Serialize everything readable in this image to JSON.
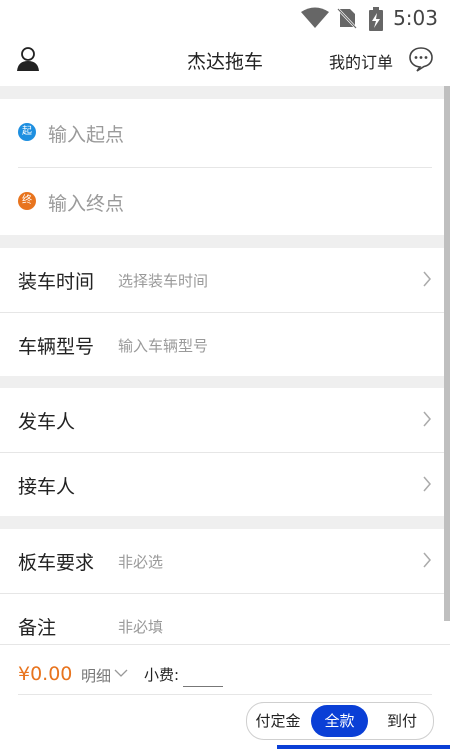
{
  "status": {
    "time": "5:03"
  },
  "header": {
    "title": "杰达拖车",
    "orders_link": "我的订单"
  },
  "address": {
    "start": {
      "badge": "起",
      "placeholder": "输入起点",
      "color": "#1e8fe0"
    },
    "end": {
      "badge": "终",
      "placeholder": "输入终点",
      "color": "#e8741e"
    }
  },
  "form": {
    "load_time": {
      "label": "装车时间",
      "hint": "选择装车时间"
    },
    "vehicle_model": {
      "label": "车辆型号",
      "hint": "输入车辆型号"
    },
    "sender": {
      "label": "发车人"
    },
    "receiver": {
      "label": "接车人"
    },
    "trailer_req": {
      "label": "板车要求",
      "hint": "非必选"
    },
    "remark": {
      "label": "备注",
      "hint": "非必填"
    }
  },
  "bottom": {
    "price": "¥0.00",
    "detail_label": "明细",
    "tip_label": "小费:",
    "payment_options": [
      "付定金",
      "全款",
      "到付"
    ],
    "selected_payment": "全款"
  },
  "colors": {
    "accent": "#0a3fd6",
    "price": "#e8741e",
    "band": "#efefef"
  }
}
